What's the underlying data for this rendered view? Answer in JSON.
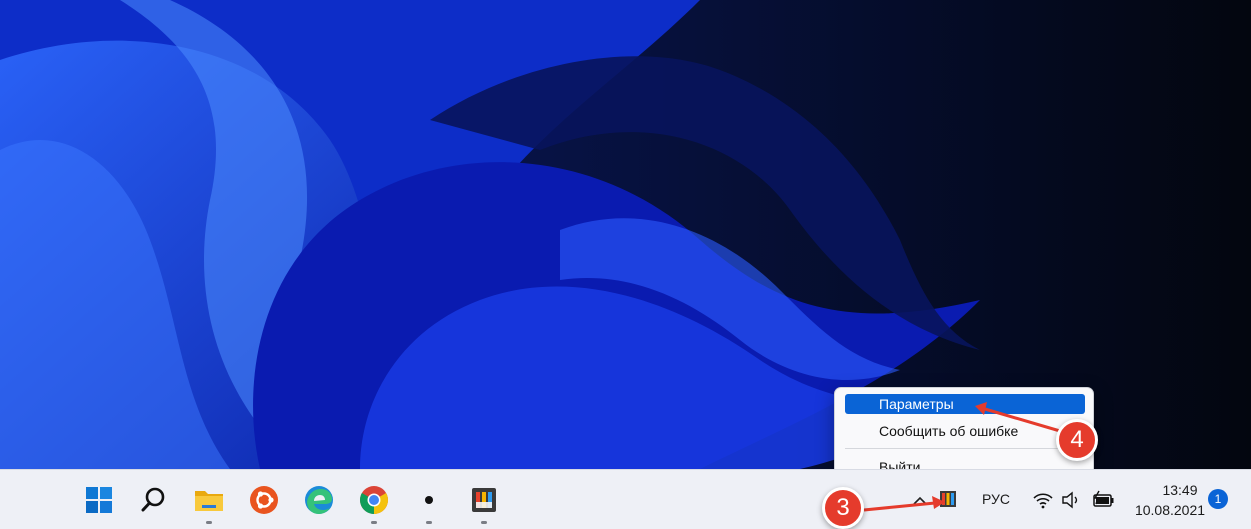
{
  "context_menu": {
    "items": [
      {
        "label": "Параметры",
        "highlighted": true
      },
      {
        "label": "Сообщить об ошибке",
        "highlighted": false
      },
      {
        "label": "Выйти",
        "highlighted": false
      }
    ]
  },
  "taskbar": {
    "apps": [
      {
        "name": "start",
        "icon": "windows-start-icon"
      },
      {
        "name": "search",
        "icon": "search-icon"
      },
      {
        "name": "file-explorer",
        "icon": "folder-icon"
      },
      {
        "name": "ubuntu",
        "icon": "ubuntu-icon"
      },
      {
        "name": "edge",
        "icon": "edge-icon"
      },
      {
        "name": "chrome",
        "icon": "chrome-icon"
      },
      {
        "name": "dot-app",
        "icon": "dot-icon"
      },
      {
        "name": "powertoys",
        "icon": "powertoys-icon"
      }
    ],
    "tray": {
      "language": "РУС",
      "time": "13:49",
      "date": "10.08.2021",
      "notification_count": "1"
    }
  },
  "callouts": {
    "step3": "3",
    "step4": "4"
  },
  "colors": {
    "accent": "#0a64d6",
    "callout": "#e53b2c",
    "taskbar": "#eef0f6"
  }
}
